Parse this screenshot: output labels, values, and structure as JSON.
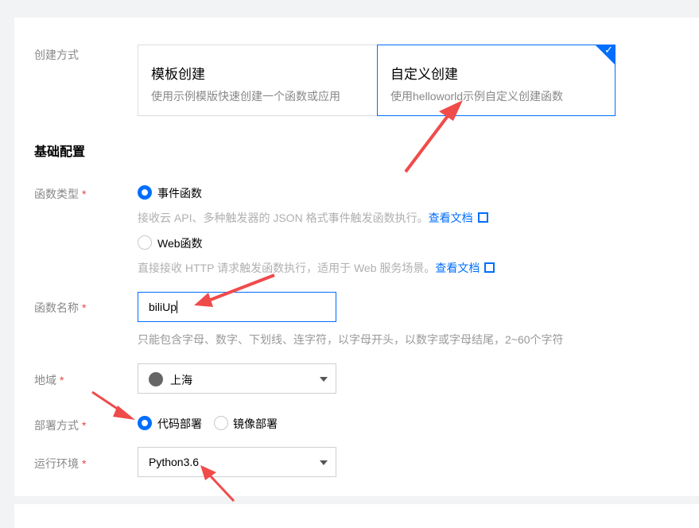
{
  "form": {
    "creation_method": {
      "label": "创建方式",
      "options": [
        {
          "title": "模板创建",
          "desc": "使用示例模版快速创建一个函数或应用",
          "selected": false
        },
        {
          "title": "自定义创建",
          "desc": "使用helloworld示例自定义创建函数",
          "selected": true
        }
      ]
    },
    "section_title": "基础配置",
    "function_type": {
      "label": "函数类型",
      "required_mark": "*",
      "options": [
        {
          "label": "事件函数",
          "selected": true,
          "hint": "接收云 API、多种触发器的 JSON 格式事件触发函数执行。",
          "link": "查看文档"
        },
        {
          "label": "Web函数",
          "selected": false,
          "hint": "直接接收 HTTP 请求触发函数执行，适用于 Web 服务场景。",
          "link": "查看文档"
        }
      ]
    },
    "function_name": {
      "label": "函数名称",
      "required_mark": "*",
      "value": "biliUp",
      "hint": "只能包含字母、数字、下划线、连字符，以字母开头，以数字或字母结尾，2~60个字符"
    },
    "region": {
      "label": "地域",
      "required_mark": "*",
      "value": "上海",
      "icon": "globe-icon"
    },
    "deploy_method": {
      "label": "部署方式",
      "required_mark": "*",
      "options": [
        {
          "label": "代码部署",
          "selected": true
        },
        {
          "label": "镜像部署",
          "selected": false
        }
      ]
    },
    "runtime": {
      "label": "运行环境",
      "required_mark": "*",
      "value": "Python3.6"
    }
  },
  "colors": {
    "accent": "#006eff",
    "annotation_arrow": "#f04b4b",
    "required": "#e54545"
  }
}
